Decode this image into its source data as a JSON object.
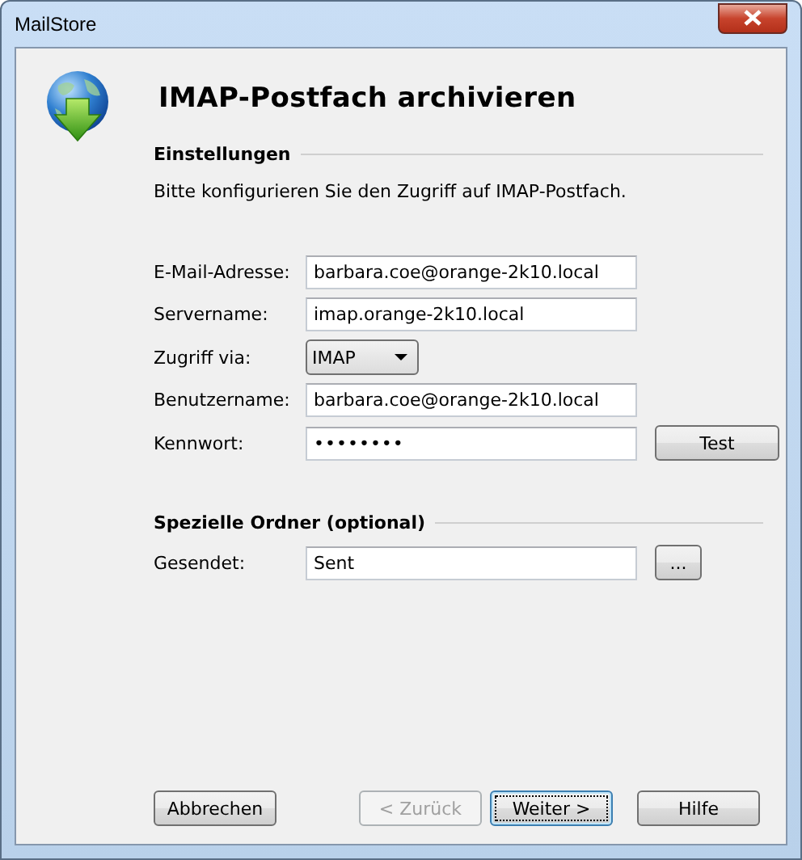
{
  "window": {
    "title": "MailStore"
  },
  "page_title": "IMAP-Postfach archivieren",
  "sections": [
    {
      "heading": "Einstellungen",
      "description": "Bitte konfigurieren Sie den Zugriff auf IMAP-Postfach.",
      "fields": [
        {
          "kind": "text",
          "label": "E-Mail-Adresse:",
          "value": "barbara.coe@orange-2k10.local"
        },
        {
          "kind": "text",
          "label": "Servername:",
          "value": "imap.orange-2k10.local"
        },
        {
          "kind": "select",
          "label": "Zugriff via:",
          "value": "IMAP"
        },
        {
          "kind": "text",
          "label": "Benutzername:",
          "value": "barbara.coe@orange-2k10.local"
        },
        {
          "kind": "password",
          "label": "Kennwort:",
          "value": "••••••••",
          "button": "Test"
        }
      ]
    },
    {
      "heading": "Spezielle Ordner (optional)",
      "fields": [
        {
          "kind": "text",
          "label": "Gesendet:",
          "value": "Sent",
          "button": "..."
        }
      ]
    }
  ],
  "buttons": [
    {
      "label": "Abbrechen",
      "disabled": false,
      "focused": false
    },
    {
      "label": "< Zurück",
      "disabled": true,
      "focused": false
    },
    {
      "label": "Weiter >",
      "disabled": false,
      "focused": true
    },
    {
      "label": "Hilfe",
      "disabled": false,
      "focused": false
    }
  ]
}
